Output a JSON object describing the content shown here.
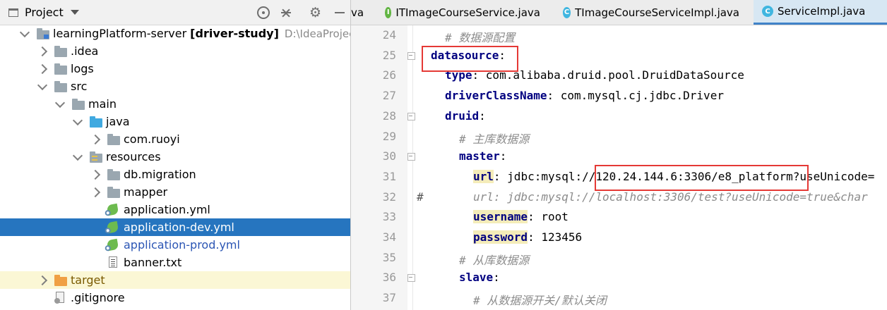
{
  "project_panel": {
    "title": "Project",
    "toolbar_icons": [
      "target-icon",
      "collapse-icon",
      "gear-icon",
      "hide-icon"
    ],
    "tree": [
      {
        "label": "learningPlatform-server",
        "branch": "[driver-study]",
        "path": "D:\\IdeaProjects\\xmjdt",
        "depth": 0,
        "expand": "down",
        "icon": "module"
      },
      {
        "label": ".idea",
        "depth": 1,
        "expand": "right",
        "icon": "folder"
      },
      {
        "label": "logs",
        "depth": 1,
        "expand": "right",
        "icon": "folder"
      },
      {
        "label": "src",
        "depth": 1,
        "expand": "down",
        "icon": "folder"
      },
      {
        "label": "main",
        "depth": 2,
        "expand": "down",
        "icon": "folder"
      },
      {
        "label": "java",
        "depth": 3,
        "expand": "down",
        "icon": "src-folder"
      },
      {
        "label": "com.ruoyi",
        "depth": 4,
        "expand": "right",
        "icon": "folder"
      },
      {
        "label": "resources",
        "depth": 3,
        "expand": "down",
        "icon": "res-folder"
      },
      {
        "label": "db.migration",
        "depth": 4,
        "expand": "right",
        "icon": "folder"
      },
      {
        "label": "mapper",
        "depth": 4,
        "expand": "right",
        "icon": "folder"
      },
      {
        "label": "application.yml",
        "depth": 4,
        "expand": "none",
        "icon": "yml"
      },
      {
        "label": "application-dev.yml",
        "depth": 4,
        "expand": "none",
        "icon": "yml",
        "state": "selected"
      },
      {
        "label": "application-prod.yml",
        "depth": 4,
        "expand": "none",
        "icon": "yml",
        "color": "#2b55b4"
      },
      {
        "label": "banner.txt",
        "depth": 4,
        "expand": "none",
        "icon": "txt"
      },
      {
        "label": "target",
        "depth": 1,
        "expand": "right",
        "icon": "target-folder",
        "state": "excluded",
        "color": "#7a5a00"
      },
      {
        "label": ".gitignore",
        "depth": 1,
        "expand": "none",
        "icon": "git"
      }
    ]
  },
  "editor": {
    "tabs": [
      {
        "label": "va",
        "icon": "",
        "partial": true
      },
      {
        "label": "ITImageCourseService.java",
        "icon": "I",
        "icon_color": "#62b543"
      },
      {
        "label": "TImageCourseServiceImpl.java",
        "icon": "C",
        "icon_color": "#40b6e0"
      },
      {
        "label": "ServiceImpl.java",
        "icon": "C",
        "icon_color": "#40b6e0",
        "active": true
      }
    ],
    "lines": [
      {
        "n": "24",
        "indent": 1,
        "parts": [
          {
            "t": "# 数据源配置",
            "c": "cmt"
          }
        ]
      },
      {
        "n": "25",
        "indent": 0,
        "parts": [
          {
            "t": "datasource",
            "c": "key"
          },
          {
            "t": ":",
            "c": "val"
          }
        ],
        "fold": true
      },
      {
        "n": "26",
        "indent": 1,
        "parts": [
          {
            "t": "type",
            "c": "key"
          },
          {
            "t": ": com.alibaba.druid.pool.DruidDataSource",
            "c": "val"
          }
        ]
      },
      {
        "n": "27",
        "indent": 1,
        "parts": [
          {
            "t": "driverClassName",
            "c": "key"
          },
          {
            "t": ": com.mysql.cj.jdbc.Driver",
            "c": "val"
          }
        ]
      },
      {
        "n": "28",
        "indent": 1,
        "parts": [
          {
            "t": "druid",
            "c": "key"
          },
          {
            "t": ":",
            "c": "val"
          }
        ],
        "fold": true
      },
      {
        "n": "29",
        "indent": 2,
        "parts": [
          {
            "t": "# 主库数据源",
            "c": "cmt"
          }
        ]
      },
      {
        "n": "30",
        "indent": 2,
        "parts": [
          {
            "t": "master",
            "c": "key"
          },
          {
            "t": ":",
            "c": "val"
          }
        ],
        "fold": true
      },
      {
        "n": "31",
        "indent": 3,
        "parts": [
          {
            "t": "url",
            "c": "key hlkey"
          },
          {
            "t": ": jdbc:mysql://",
            "c": "val"
          },
          {
            "t": "120.24.144.6:3306/e8_platform",
            "c": "val"
          },
          {
            "t": "?useUnicode=",
            "c": "val"
          }
        ]
      },
      {
        "n": "32",
        "indent": 3,
        "parts": [
          {
            "t": " url: jdbc:mysql://localhost:3306/test?useUnicode=true&char",
            "c": "cmt"
          }
        ],
        "hash": "#"
      },
      {
        "n": "33",
        "indent": 3,
        "parts": [
          {
            "t": "username",
            "c": "key hlkey"
          },
          {
            "t": ": root",
            "c": "val"
          }
        ]
      },
      {
        "n": "34",
        "indent": 3,
        "parts": [
          {
            "t": "password",
            "c": "key hlkey"
          },
          {
            "t": ": 123456",
            "c": "val"
          }
        ]
      },
      {
        "n": "35",
        "indent": 2,
        "parts": [
          {
            "t": "# 从库数据源",
            "c": "cmt"
          }
        ]
      },
      {
        "n": "36",
        "indent": 2,
        "parts": [
          {
            "t": "slave",
            "c": "key"
          },
          {
            "t": ":",
            "c": "val"
          }
        ],
        "fold": true
      },
      {
        "n": "37",
        "indent": 3,
        "parts": [
          {
            "t": "# 从数据源开关/默认关闭",
            "c": "cmt"
          }
        ]
      }
    ]
  }
}
